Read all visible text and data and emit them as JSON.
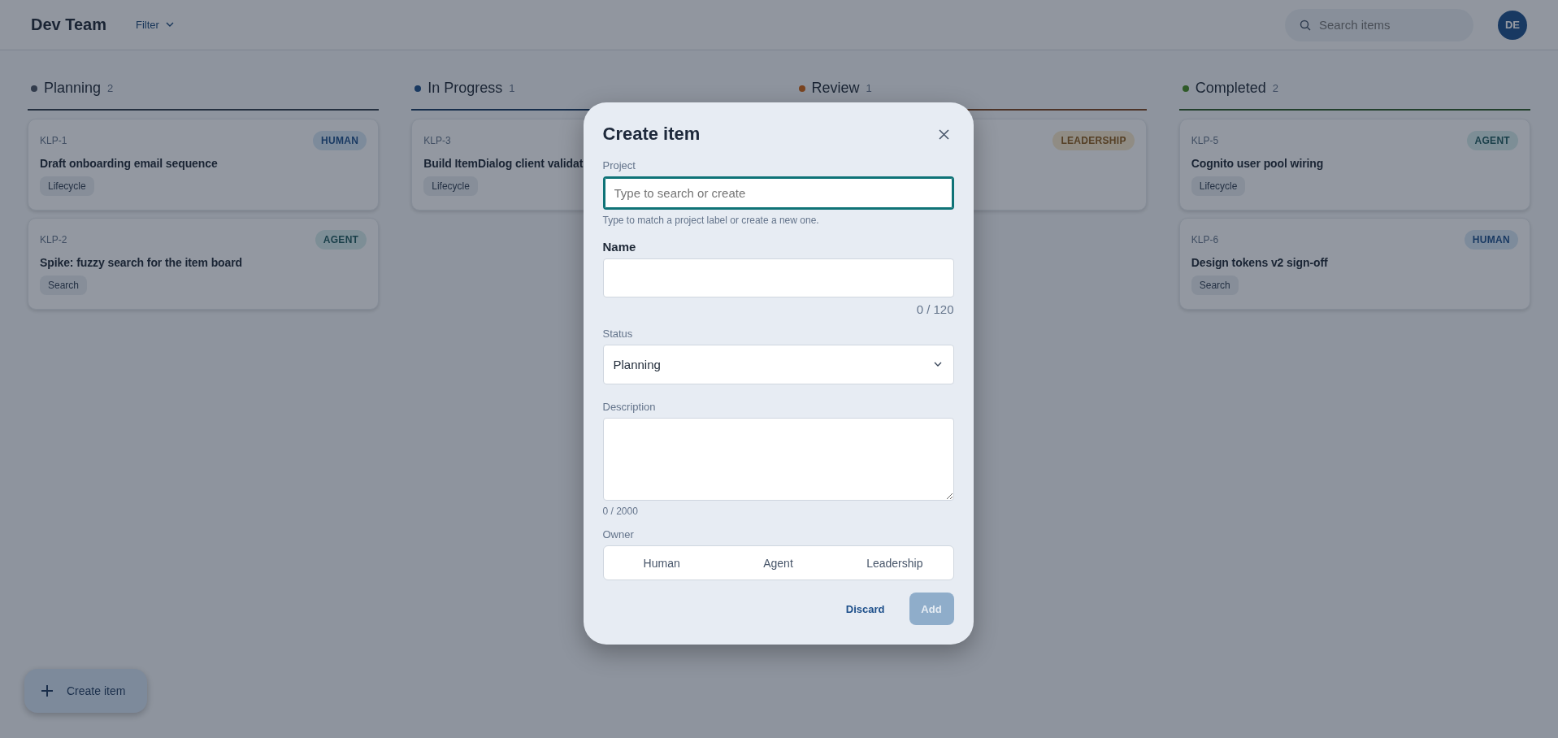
{
  "header": {
    "title": "Dev Team",
    "filter": "Filter",
    "search": {
      "placeholder": "Search items"
    },
    "avatar": "DE"
  },
  "columns": [
    {
      "name": "Planning",
      "count": "2",
      "color": "#323c4c",
      "cards": [
        {
          "id": "KLP-1",
          "title": "Draft onboarding email sequence",
          "tag": "Lifecycle",
          "owner": {
            "label": "HUMAN",
            "kind": "human"
          }
        },
        {
          "id": "KLP-2",
          "title": "Spike: fuzzy search for the item board",
          "tag": "Search",
          "owner": {
            "label": "AGENT",
            "kind": "agent"
          }
        }
      ]
    },
    {
      "name": "In Progress",
      "count": "1",
      "color": "#193961",
      "cards": [
        {
          "id": "KLP-3",
          "title": "Build ItemDialog client validat",
          "tag": "Lifecycle"
        }
      ]
    },
    {
      "name": "Review",
      "count": "1",
      "color": "#7a4420",
      "cards": [
        {
          "owner": {
            "label": "LEADERSHIP",
            "kind": "leadership"
          }
        }
      ]
    },
    {
      "name": "Completed",
      "count": "2",
      "color": "#2f5a28",
      "cards": [
        {
          "id": "KLP-5",
          "title": "Cognito user pool wiring",
          "tag": "Lifecycle",
          "owner": {
            "label": "AGENT",
            "kind": "agent"
          }
        },
        {
          "id": "KLP-6",
          "title": "Design tokens v2 sign-off",
          "tag": "Search",
          "owner": {
            "label": "HUMAN",
            "kind": "human"
          }
        }
      ]
    }
  ],
  "fab": {
    "label": "Create item"
  },
  "dialog": {
    "title": "Create item",
    "project": {
      "label": "Project",
      "placeholder": "Type to search or create",
      "focused": true,
      "helper": "Type to match a project label or create a new one."
    },
    "name": {
      "label": "Name",
      "emphasized": true,
      "counter": "0 / 120"
    },
    "status": {
      "label": "Status",
      "value": "Planning"
    },
    "description": {
      "label": "Description",
      "counter": "0 / 2000"
    },
    "owner": {
      "label": "Owner",
      "options": [
        {
          "label": "Human",
          "selected": false
        },
        {
          "label": "Agent",
          "selected": false
        },
        {
          "label": "Leadership",
          "selected": false
        }
      ]
    },
    "discard": "Discard",
    "add": {
      "label": "Add",
      "disabled": true
    }
  }
}
